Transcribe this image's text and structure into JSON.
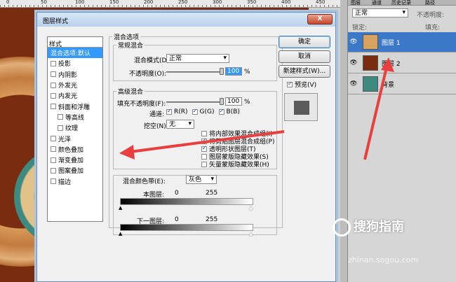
{
  "ruler": {
    "ticks": [
      "0",
      "50",
      "100",
      "150",
      "200",
      "250",
      "300",
      "350",
      "400",
      "450"
    ]
  },
  "dialog": {
    "title": "图层样式",
    "close_label": "X",
    "style_panel": {
      "header": "样式",
      "items": [
        {
          "label": "混合选项:默认",
          "checkbox": false,
          "selected": true,
          "sub": false
        },
        {
          "label": "投影",
          "checkbox": true,
          "selected": false,
          "sub": false
        },
        {
          "label": "内阴影",
          "checkbox": true,
          "selected": false,
          "sub": false
        },
        {
          "label": "外发光",
          "checkbox": true,
          "selected": false,
          "sub": false
        },
        {
          "label": "内发光",
          "checkbox": true,
          "selected": false,
          "sub": false
        },
        {
          "label": "斜面和浮雕",
          "checkbox": true,
          "selected": false,
          "sub": false
        },
        {
          "label": "等高线",
          "checkbox": true,
          "selected": false,
          "sub": true
        },
        {
          "label": "纹理",
          "checkbox": true,
          "selected": false,
          "sub": true
        },
        {
          "label": "光泽",
          "checkbox": true,
          "selected": false,
          "sub": false
        },
        {
          "label": "颜色叠加",
          "checkbox": true,
          "selected": false,
          "sub": false
        },
        {
          "label": "渐变叠加",
          "checkbox": true,
          "selected": false,
          "sub": false
        },
        {
          "label": "图案叠加",
          "checkbox": true,
          "selected": false,
          "sub": false
        },
        {
          "label": "描边",
          "checkbox": true,
          "selected": false,
          "sub": false
        }
      ]
    },
    "blend_options": {
      "legend": "混合选项",
      "general": {
        "legend": "常规混合",
        "mode_label": "混合模式(D):",
        "mode_value": "正常",
        "opacity_label": "不透明度(O):",
        "opacity_value": "100",
        "percent": "%"
      },
      "advanced": {
        "legend": "高级混合",
        "fill_label": "填充不透明度(F):",
        "fill_value": "100",
        "percent": "%",
        "channels_label": "通道:",
        "channels": [
          {
            "label": "R(R)",
            "checked": true
          },
          {
            "label": "G(G)",
            "checked": true
          },
          {
            "label": "B(B)",
            "checked": true
          }
        ],
        "knockout_label": "挖空(N):",
        "knockout_value": "无",
        "options": [
          {
            "label": "将内部效果混合成组(I)",
            "checked": false
          },
          {
            "label": "将剪贴图层混合成组(P)",
            "checked": true
          },
          {
            "label": "透明形状图层(T)",
            "checked": true
          },
          {
            "label": "图层蒙版隐藏效果(S)",
            "checked": false
          },
          {
            "label": "矢量蒙版隐藏效果(H)",
            "checked": false
          }
        ]
      },
      "blend_if": {
        "label": "混合颜色带(E):",
        "value": "灰色",
        "this_layer_label": "本图层:",
        "this_low": "0",
        "this_high": "255",
        "underlying_label": "下一图层:",
        "under_low": "0",
        "under_high": "255"
      }
    },
    "buttons": {
      "ok": "确定",
      "cancel": "取消",
      "new_style": "新建样式(W)...",
      "preview_label": "预览(V)",
      "preview_checked": true
    }
  },
  "layers_panel": {
    "tabs": [
      "图层",
      "通道",
      "历史记录",
      "路径"
    ],
    "blend_mode": "正常",
    "opacity_label": "不透明度:",
    "lock_label": "锁定:",
    "fill_label": "填充:",
    "layers": [
      {
        "name": "图层 1",
        "selected": true,
        "thumb_color": "#d7a25f"
      },
      {
        "name": "图层 2",
        "selected": false,
        "thumb_color": "#7a2c10"
      },
      {
        "name": "背景",
        "selected": false,
        "thumb_color": "#3d8a80"
      }
    ]
  },
  "annotation_color": "#e8403f",
  "watermark": {
    "text": "搜狗指南",
    "url": "zhinan.sogou.com"
  }
}
